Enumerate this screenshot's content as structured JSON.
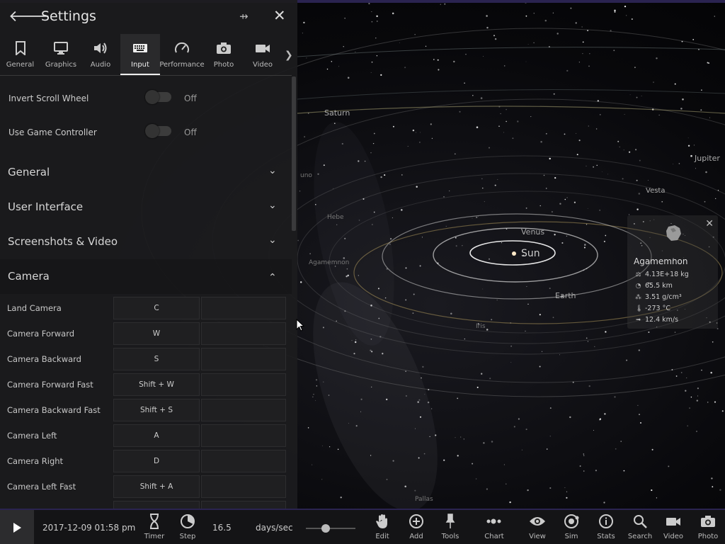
{
  "header": {
    "title": "Settings"
  },
  "tabs": [
    {
      "label": "General",
      "icon": "bookmark-icon"
    },
    {
      "label": "Graphics",
      "icon": "monitor-icon"
    },
    {
      "label": "Audio",
      "icon": "speaker-icon"
    },
    {
      "label": "Input",
      "icon": "keyboard-icon",
      "active": true
    },
    {
      "label": "Performance",
      "icon": "gauge-icon"
    },
    {
      "label": "Photo",
      "icon": "camera-icon"
    },
    {
      "label": "Video",
      "icon": "video-icon"
    }
  ],
  "toggles": [
    {
      "label": "Invert Scroll Wheel",
      "value": "Off"
    },
    {
      "label": "Use Game Controller",
      "value": "Off"
    }
  ],
  "sections": [
    {
      "label": "General",
      "expanded": false
    },
    {
      "label": "User Interface",
      "expanded": false
    },
    {
      "label": "Screenshots & Video",
      "expanded": false
    },
    {
      "label": "Camera",
      "expanded": true
    }
  ],
  "bindings": [
    {
      "action": "Land Camera",
      "key": "C"
    },
    {
      "action": "Camera Forward",
      "key": "W"
    },
    {
      "action": "Camera Backward",
      "key": "S"
    },
    {
      "action": "Camera Forward Fast",
      "key": "Shift + W"
    },
    {
      "action": "Camera Backward Fast",
      "key": "Shift + S"
    },
    {
      "action": "Camera Left",
      "key": "A"
    },
    {
      "action": "Camera Right",
      "key": "D"
    },
    {
      "action": "Camera Left Fast",
      "key": "Shift + A"
    }
  ],
  "space_labels": {
    "saturn": "Saturn",
    "jupiter": "Jupiter",
    "vesta": "Vesta",
    "venus": "Venus",
    "sun": "Sun",
    "earth": "Earth",
    "iris": "Iris",
    "hebe": "Hebe",
    "agamemnon_small": "Agamemnon",
    "pallas": "Pallas",
    "juno": "uno"
  },
  "info_card": {
    "name": "Agamemnon",
    "mass": "4.13E+18 kg",
    "radius": "65.5 km",
    "density": "3.51 g/cm³",
    "temperature": "-273 °C",
    "velocity": "12.4 km/s"
  },
  "bottom_bar": {
    "date": "2017-12-09 01:58 pm",
    "speed_value": "16.5",
    "speed_unit": "days/sec",
    "speed_slider_fraction": 0.4,
    "buttons": {
      "timer": "Timer",
      "step": "Step",
      "edit": "Edit",
      "add": "Add",
      "tools": "Tools",
      "chart": "Chart",
      "view": "View",
      "sim": "Sim",
      "stats": "Stats",
      "search": "Search",
      "video": "Video",
      "photo": "Photo"
    }
  },
  "colors": {
    "panel_bg": "#1c1c1e",
    "accent_border": "#2a2350",
    "text": "#dddddd"
  }
}
